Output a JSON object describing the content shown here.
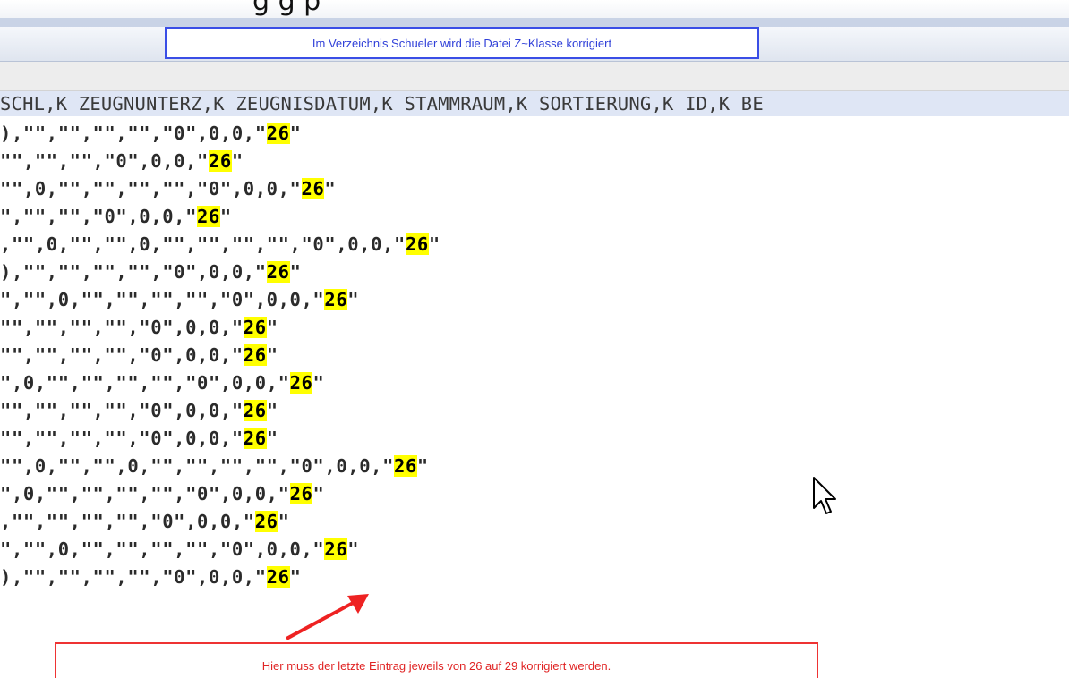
{
  "title_fragment": "g g p",
  "toolbar_callout": "Im Verzeichnis Schueler wird die Datei Z~Klasse korrigiert",
  "header_text": "SCHL,K_ZEUGNUNTERZ,K_ZEUGNISDATUM,K_STAMMRAUM,K_SORTIERUNG,K_ID,K_BE",
  "lines": [
    {
      "prefix": "),\"\",\"\",\"\",\"\",\"0\",0,0,\"",
      "value": "26",
      "suffix": "\""
    },
    {
      "prefix": "\"\",\"\",\"\",\"0\",0,0,\"",
      "value": "26",
      "suffix": "\""
    },
    {
      "prefix": "\"\",0,\"\",\"\",\"\",\"\",\"0\",0,0,\"",
      "value": "26",
      "suffix": "\""
    },
    {
      "prefix": "\",\"\",\"\",\"0\",0,0,\"",
      "value": "26",
      "suffix": "\""
    },
    {
      "prefix": ",\"\",0,\"\",\"\",0,\"\",\"\",\"\",\"\",\"0\",0,0,\"",
      "value": "26",
      "suffix": "\""
    },
    {
      "prefix": "),\"\",\"\",\"\",\"\",\"0\",0,0,\"",
      "value": "26",
      "suffix": "\""
    },
    {
      "prefix": "\",\"\",0,\"\",\"\",\"\",\"\",\"0\",0,0,\"",
      "value": "26",
      "suffix": "\""
    },
    {
      "prefix": "\"\",\"\",\"\",\"\",\"0\",0,0,\"",
      "value": "26",
      "suffix": "\""
    },
    {
      "prefix": "\"\",\"\",\"\",\"\",\"0\",0,0,\"",
      "value": "26",
      "suffix": "\""
    },
    {
      "prefix": "\",0,\"\",\"\",\"\",\"\",\"0\",0,0,\"",
      "value": "26",
      "suffix": "\""
    },
    {
      "prefix": "\"\",\"\",\"\",\"\",\"0\",0,0,\"",
      "value": "26",
      "suffix": "\""
    },
    {
      "prefix": "\"\",\"\",\"\",\"\",\"0\",0,0,\"",
      "value": "26",
      "suffix": "\""
    },
    {
      "prefix": "\"\",0,\"\",\"\",0,\"\",\"\",\"\",\"\",\"0\",0,0,\"",
      "value": "26",
      "suffix": "\""
    },
    {
      "prefix": "\",0,\"\",\"\",\"\",\"\",\"0\",0,0,\"",
      "value": "26",
      "suffix": "\""
    },
    {
      "prefix": ",\"\",\"\",\"\",\"\",\"0\",0,0,\"",
      "value": "26",
      "suffix": "\""
    },
    {
      "prefix": "\",\"\",0,\"\",\"\",\"\",\"\",\"0\",0,0,\"",
      "value": "26",
      "suffix": "\""
    },
    {
      "prefix": "),\"\",\"\",\"\",\"\",\"0\",0,0,\"",
      "value": "26",
      "suffix": "\""
    }
  ],
  "bottom_callout": "Hier muss der letzte Eintrag jeweils von 26 auf 29 korrigiert werden.",
  "colors": {
    "highlight": "#ffff00",
    "callout_blue": "#3a4ee6",
    "callout_red": "#ee3333",
    "header_band": "#dfe6f5"
  },
  "icons": {
    "cursor": "mouse-pointer-icon",
    "arrow": "red-arrow-icon"
  }
}
